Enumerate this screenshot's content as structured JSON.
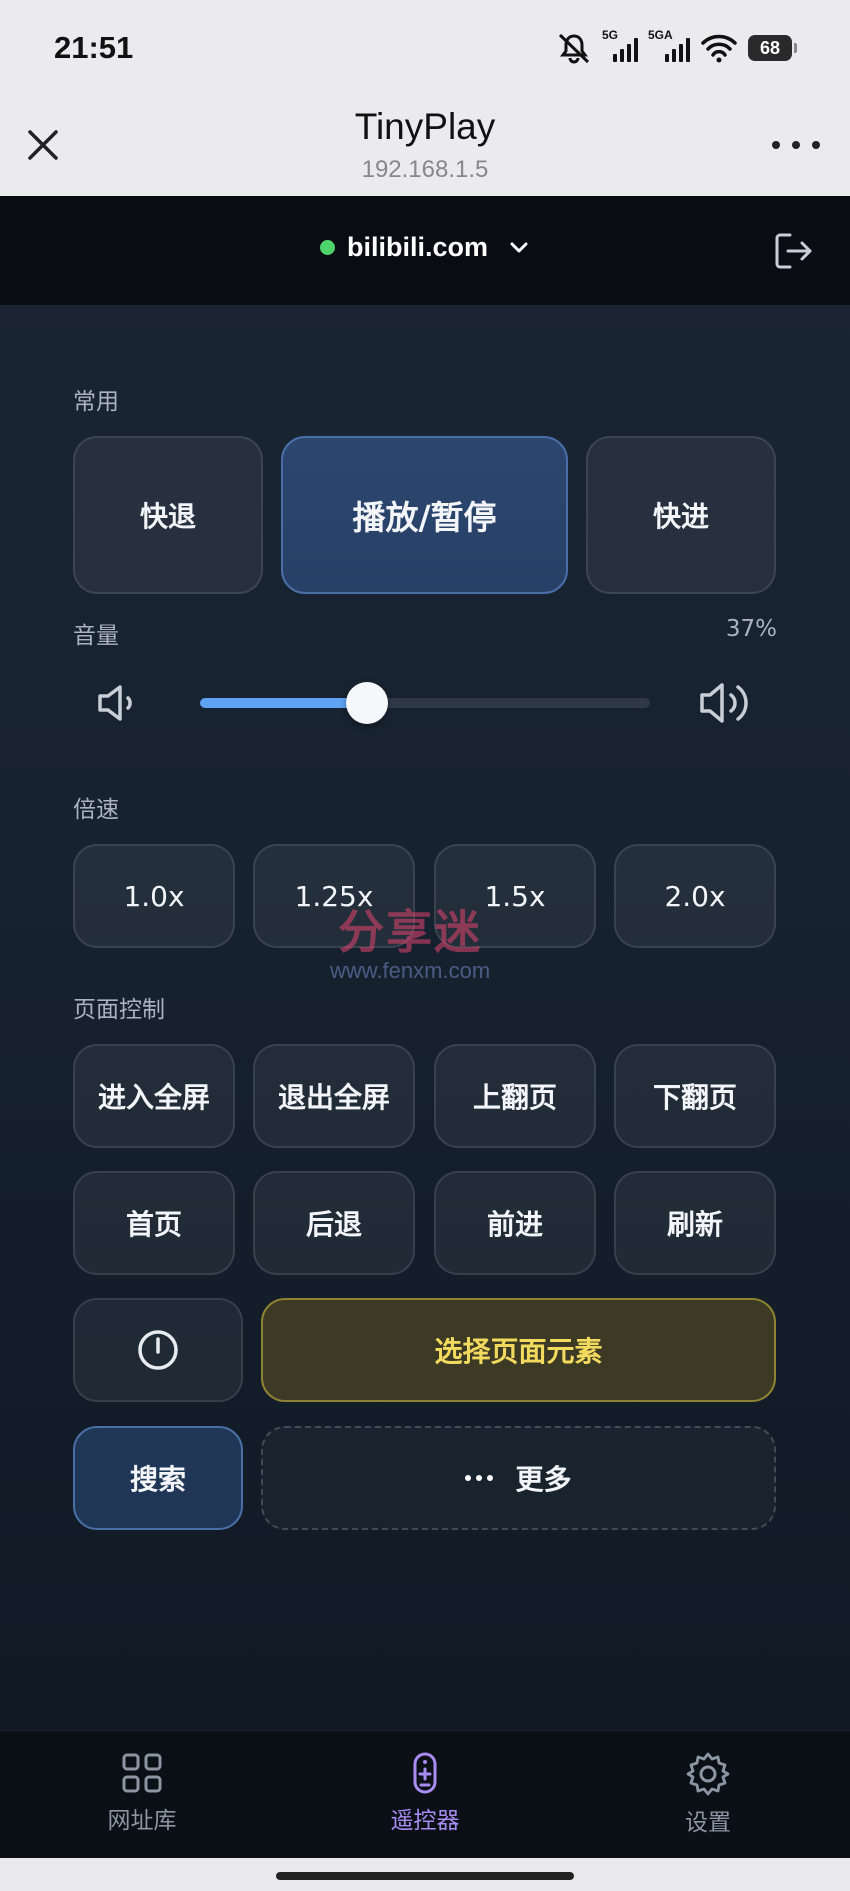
{
  "status_bar": {
    "time": "21:51",
    "signal1_label": "5G",
    "signal2_label": "5GA",
    "battery": "68",
    "icons": [
      "mute-icon",
      "signal-icon",
      "signal-icon",
      "wifi-icon",
      "battery-icon"
    ]
  },
  "header": {
    "title": "TinyPlay",
    "subtitle": "192.168.1.5"
  },
  "site_selector": {
    "site": "bilibili.com",
    "status_color": "#4ed36a"
  },
  "sections": {
    "common": "常用",
    "volume": "音量",
    "speed": "倍速",
    "page_control": "页面控制"
  },
  "common_buttons": {
    "rewind": "快退",
    "play_pause": "播放/暂停",
    "forward": "快进"
  },
  "volume": {
    "percent_label": "37%",
    "value": 0.37
  },
  "speeds": [
    "1.0x",
    "1.25x",
    "1.5x",
    "2.0x"
  ],
  "page_buttons_row1": [
    "进入全屏",
    "退出全屏",
    "上翻页",
    "下翻页"
  ],
  "page_buttons_row2": [
    "首页",
    "后退",
    "前进",
    "刷新"
  ],
  "actions": {
    "select_element": "选择页面元素",
    "search": "搜索",
    "more": "更多"
  },
  "watermark": {
    "text": "分享迷",
    "url": "www.fenxm.com"
  },
  "bottom_nav": [
    {
      "label": "网址库",
      "icon": "grid-icon",
      "active": false
    },
    {
      "label": "遥控器",
      "icon": "remote-icon",
      "active": true
    },
    {
      "label": "设置",
      "icon": "gear-icon",
      "active": false
    }
  ],
  "colors": {
    "accent_blue": "#5ea2f3",
    "accent_purple": "#a98cf2",
    "accent_yellow": "#f1da5e"
  }
}
